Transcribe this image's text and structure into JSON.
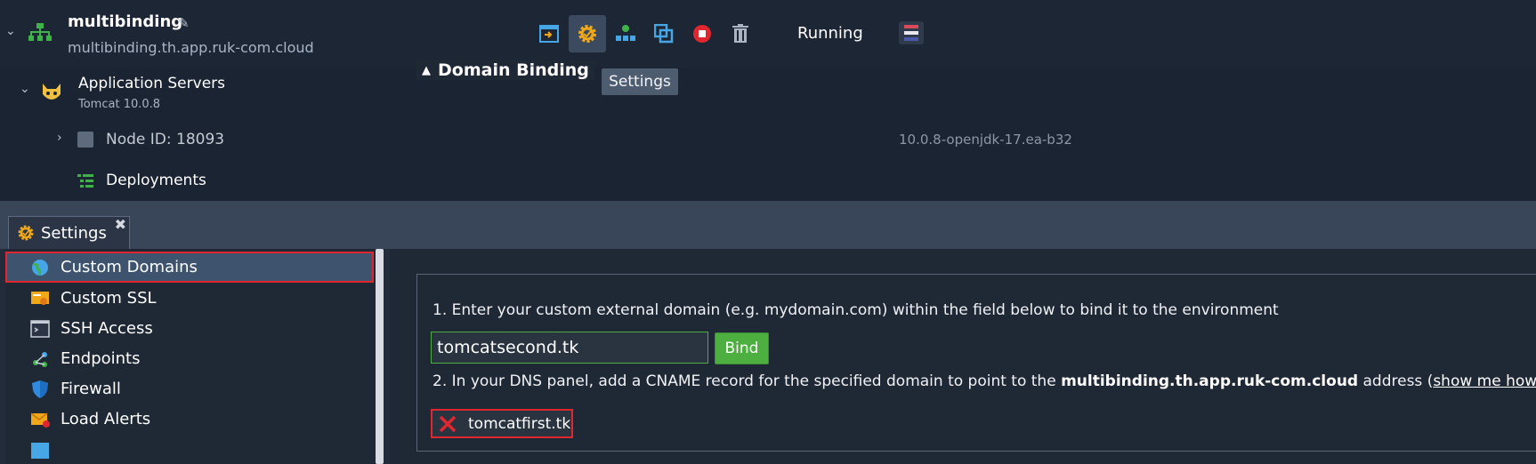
{
  "environment": {
    "name": "multibinding",
    "url": "multibinding.th.app.ruk-com.cloud",
    "status": "Running",
    "toolbar_icons": [
      "deploy-icon",
      "settings-gear-icon",
      "topology-icon",
      "clone-icon",
      "stop-icon",
      "trash-icon"
    ],
    "tooltip": "Settings"
  },
  "layer": {
    "name": "Application Servers",
    "subtitle": "Tomcat 10.0.8",
    "node_id": "Node ID: 18093",
    "node_version": "10.0.8-openjdk-17.ea-b32",
    "deployments": "Deployments"
  },
  "settings": {
    "tab_label": "Settings",
    "close_glyph": "✖",
    "sidebar": [
      {
        "label": "Custom Domains",
        "icon": "globe-icon",
        "selected": true
      },
      {
        "label": "Custom SSL",
        "icon": "certificate-icon",
        "selected": false
      },
      {
        "label": "SSH Access",
        "icon": "terminal-icon",
        "selected": false
      },
      {
        "label": "Endpoints",
        "icon": "endpoints-icon",
        "selected": false
      },
      {
        "label": "Firewall",
        "icon": "shield-icon",
        "selected": false
      },
      {
        "label": "Load Alerts",
        "icon": "mail-alert-icon",
        "selected": false
      }
    ],
    "domain_binding": {
      "title": "Domain Binding",
      "step1": "1. Enter your custom external domain (e.g. mydomain.com) within the field below to bind it to the environment",
      "input_value": "tomcatsecond.tk",
      "bind_label": "Bind",
      "step2_prefix": "2. In your DNS panel, add a CNAME record for the specified domain to point to the ",
      "step2_domain": "multibinding.th.app.ruk-com.cloud",
      "step2_suffix": " address (",
      "step2_link": "show me how",
      "step2_end": ")",
      "bound_domain": "tomcatfirst.tk"
    }
  },
  "colors": {
    "accent_green": "#4caf3f",
    "highlight_red": "#e0262f",
    "gear_orange": "#f0a818"
  }
}
